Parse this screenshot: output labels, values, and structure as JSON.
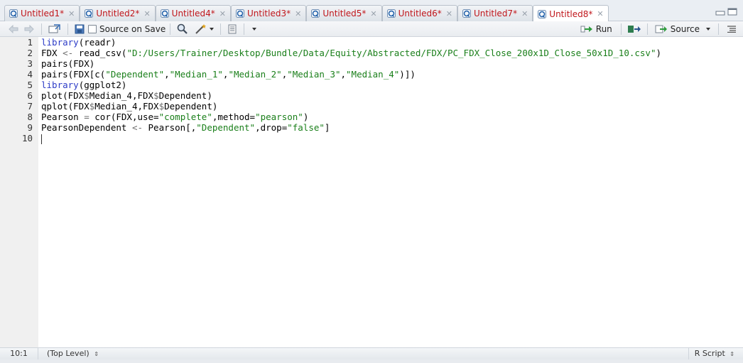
{
  "tabs": [
    {
      "label": "Untitled1*",
      "active": false
    },
    {
      "label": "Untitled2*",
      "active": false
    },
    {
      "label": "Untitled4*",
      "active": false
    },
    {
      "label": "Untitled3*",
      "active": false
    },
    {
      "label": "Untitled5*",
      "active": false
    },
    {
      "label": "Untitled6*",
      "active": false
    },
    {
      "label": "Untitled7*",
      "active": false
    },
    {
      "label": "Untitled8*",
      "active": true
    }
  ],
  "toolbar": {
    "source_on_save_label": "Source on Save",
    "run_label": "Run",
    "source_label": "Source"
  },
  "editor": {
    "line_numbers": [
      "1",
      "2",
      "3",
      "4",
      "5",
      "6",
      "7",
      "8",
      "9",
      "10"
    ],
    "lines": [
      [
        {
          "t": "library",
          "c": "kw"
        },
        {
          "t": "(readr)",
          "c": ""
        }
      ],
      [
        {
          "t": "FDX ",
          "c": ""
        },
        {
          "t": "<-",
          "c": "op"
        },
        {
          "t": " read_csv(",
          "c": ""
        },
        {
          "t": "\"D:/Users/Trainer/Desktop/Bundle/Data/Equity/Abstracted/FDX/PC_FDX_Close_200x1D_Close_50x1D_10.csv\"",
          "c": "str"
        },
        {
          "t": ")",
          "c": ""
        }
      ],
      [
        {
          "t": "pairs(FDX)",
          "c": ""
        }
      ],
      [
        {
          "t": "pairs(FDX[c(",
          "c": ""
        },
        {
          "t": "\"Dependent\"",
          "c": "str"
        },
        {
          "t": ",",
          "c": ""
        },
        {
          "t": "\"Median_1\"",
          "c": "str"
        },
        {
          "t": ",",
          "c": ""
        },
        {
          "t": "\"Median_2\"",
          "c": "str"
        },
        {
          "t": ",",
          "c": ""
        },
        {
          "t": "\"Median_3\"",
          "c": "str"
        },
        {
          "t": ",",
          "c": ""
        },
        {
          "t": "\"Median_4\"",
          "c": "str"
        },
        {
          "t": ")])",
          "c": ""
        }
      ],
      [
        {
          "t": "library",
          "c": "kw"
        },
        {
          "t": "(ggplot2)",
          "c": ""
        }
      ],
      [
        {
          "t": "plot(FDX",
          "c": ""
        },
        {
          "t": "$",
          "c": "op"
        },
        {
          "t": "Median_4,FDX",
          "c": ""
        },
        {
          "t": "$",
          "c": "op"
        },
        {
          "t": "Dependent)",
          "c": ""
        }
      ],
      [
        {
          "t": "qplot(FDX",
          "c": ""
        },
        {
          "t": "$",
          "c": "op"
        },
        {
          "t": "Median_4,FDX",
          "c": ""
        },
        {
          "t": "$",
          "c": "op"
        },
        {
          "t": "Dependent)",
          "c": ""
        }
      ],
      [
        {
          "t": "Pearson ",
          "c": ""
        },
        {
          "t": "=",
          "c": "op"
        },
        {
          "t": " cor(FDX,use=",
          "c": ""
        },
        {
          "t": "\"complete\"",
          "c": "str"
        },
        {
          "t": ",method=",
          "c": ""
        },
        {
          "t": "\"pearson\"",
          "c": "str"
        },
        {
          "t": ")",
          "c": ""
        }
      ],
      [
        {
          "t": "PearsonDependent ",
          "c": ""
        },
        {
          "t": "<-",
          "c": "op"
        },
        {
          "t": " Pearson[,",
          "c": ""
        },
        {
          "t": "\"Dependent\"",
          "c": "str"
        },
        {
          "t": ",drop=",
          "c": ""
        },
        {
          "t": "\"false\"",
          "c": "str"
        },
        {
          "t": "]",
          "c": ""
        }
      ],
      []
    ]
  },
  "status": {
    "position": "10:1",
    "scope": "(Top Level)",
    "file_type": "R Script"
  }
}
